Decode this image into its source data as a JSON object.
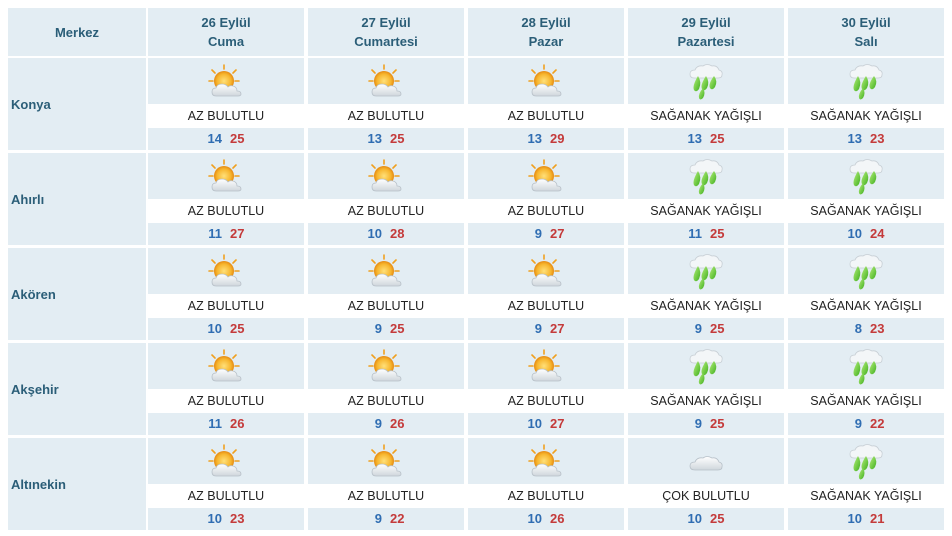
{
  "header": {
    "center_label": "Merkez",
    "days": [
      {
        "date": "26 Eylül",
        "weekday": "Cuma"
      },
      {
        "date": "27 Eylül",
        "weekday": "Cumartesi"
      },
      {
        "date": "28 Eylül",
        "weekday": "Pazar"
      },
      {
        "date": "29 Eylül",
        "weekday": "Pazartesi"
      },
      {
        "date": "30 Eylül",
        "weekday": "Salı"
      }
    ]
  },
  "cities": [
    {
      "name": "Konya",
      "days": [
        {
          "icon": "sun-cloud-icon",
          "condition": "AZ BULUTLU",
          "min": "14",
          "max": "25"
        },
        {
          "icon": "sun-cloud-icon",
          "condition": "AZ BULUTLU",
          "min": "13",
          "max": "25"
        },
        {
          "icon": "sun-cloud-icon",
          "condition": "AZ BULUTLU",
          "min": "13",
          "max": "29"
        },
        {
          "icon": "heavy-rain-icon",
          "condition": "SAĞANAK YAĞIŞLI",
          "min": "13",
          "max": "25"
        },
        {
          "icon": "heavy-rain-icon",
          "condition": "SAĞANAK YAĞIŞLI",
          "min": "13",
          "max": "23"
        }
      ]
    },
    {
      "name": "Ahırlı",
      "days": [
        {
          "icon": "sun-cloud-icon",
          "condition": "AZ BULUTLU",
          "min": "11",
          "max": "27"
        },
        {
          "icon": "sun-cloud-icon",
          "condition": "AZ BULUTLU",
          "min": "10",
          "max": "28"
        },
        {
          "icon": "sun-cloud-icon",
          "condition": "AZ BULUTLU",
          "min": "9",
          "max": "27"
        },
        {
          "icon": "heavy-rain-icon",
          "condition": "SAĞANAK YAĞIŞLI",
          "min": "11",
          "max": "25"
        },
        {
          "icon": "heavy-rain-icon",
          "condition": "SAĞANAK YAĞIŞLI",
          "min": "10",
          "max": "24"
        }
      ]
    },
    {
      "name": "Akören",
      "days": [
        {
          "icon": "sun-cloud-icon",
          "condition": "AZ BULUTLU",
          "min": "10",
          "max": "25"
        },
        {
          "icon": "sun-cloud-icon",
          "condition": "AZ BULUTLU",
          "min": "9",
          "max": "25"
        },
        {
          "icon": "sun-cloud-icon",
          "condition": "AZ BULUTLU",
          "min": "9",
          "max": "27"
        },
        {
          "icon": "heavy-rain-icon",
          "condition": "SAĞANAK YAĞIŞLI",
          "min": "9",
          "max": "25"
        },
        {
          "icon": "heavy-rain-icon",
          "condition": "SAĞANAK YAĞIŞLI",
          "min": "8",
          "max": "23"
        }
      ]
    },
    {
      "name": "Akşehir",
      "days": [
        {
          "icon": "sun-cloud-icon",
          "condition": "AZ BULUTLU",
          "min": "11",
          "max": "26"
        },
        {
          "icon": "sun-cloud-icon",
          "condition": "AZ BULUTLU",
          "min": "9",
          "max": "26"
        },
        {
          "icon": "sun-cloud-icon",
          "condition": "AZ BULUTLU",
          "min": "10",
          "max": "27"
        },
        {
          "icon": "heavy-rain-icon",
          "condition": "SAĞANAK YAĞIŞLI",
          "min": "9",
          "max": "25"
        },
        {
          "icon": "heavy-rain-icon",
          "condition": "SAĞANAK YAĞIŞLI",
          "min": "9",
          "max": "22"
        }
      ]
    },
    {
      "name": "Altınekin",
      "days": [
        {
          "icon": "sun-cloud-icon",
          "condition": "AZ BULUTLU",
          "min": "10",
          "max": "23"
        },
        {
          "icon": "sun-cloud-icon",
          "condition": "AZ BULUTLU",
          "min": "9",
          "max": "22"
        },
        {
          "icon": "sun-cloud-icon",
          "condition": "AZ BULUTLU",
          "min": "10",
          "max": "26"
        },
        {
          "icon": "cloud-icon",
          "condition": "ÇOK BULUTLU",
          "min": "10",
          "max": "25"
        },
        {
          "icon": "heavy-rain-icon",
          "condition": "SAĞANAK YAĞIŞLI",
          "min": "10",
          "max": "21"
        }
      ]
    }
  ],
  "colors": {
    "header_bg": "#e3edf3",
    "header_text": "#2b5e78",
    "min_temp": "#2f6db2",
    "max_temp": "#c43a3a",
    "rain_green": "#6fcf2e"
  }
}
